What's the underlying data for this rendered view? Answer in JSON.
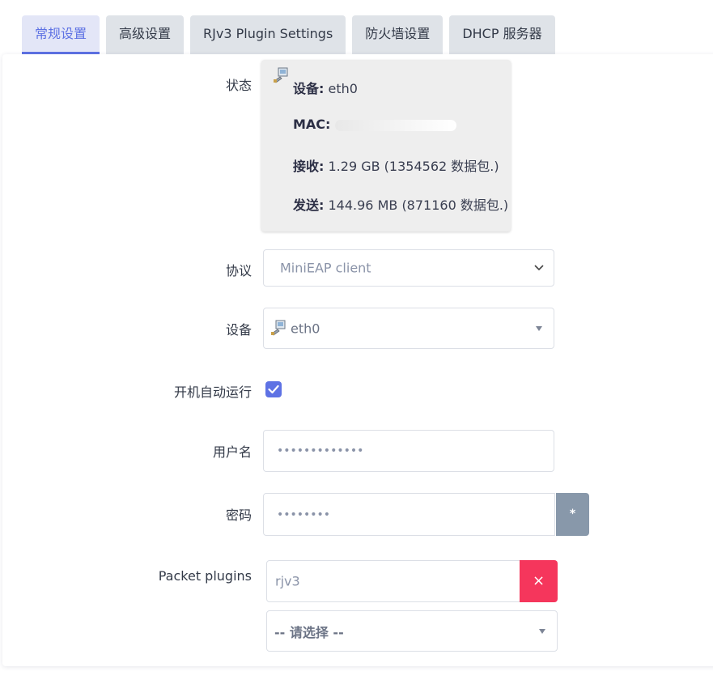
{
  "tabs": [
    {
      "label": "常规设置",
      "active": true
    },
    {
      "label": "高级设置",
      "active": false
    },
    {
      "label": "RJv3 Plugin Settings",
      "active": false
    },
    {
      "label": "防火墙设置",
      "active": false
    },
    {
      "label": "DHCP 服务器",
      "active": false
    }
  ],
  "status": {
    "label": "状态",
    "device_key": "设备:",
    "device_value": "eth0",
    "mac_key": "MAC:",
    "rx_key": "接收:",
    "rx_value": "1.29 GB (1354562 数据包.)",
    "tx_key": "发送:",
    "tx_value": "144.96 MB (871160 数据包.)"
  },
  "protocol": {
    "label": "协议",
    "value": "MiniEAP client"
  },
  "device": {
    "label": "设备",
    "value": "eth0"
  },
  "autostart": {
    "label": "开机自动运行",
    "checked": true
  },
  "username": {
    "label": "用户名",
    "value": "•••••••••••••"
  },
  "password": {
    "label": "密码",
    "value": "••••••••",
    "reveal_label": "*"
  },
  "packet_plugins": {
    "label": "Packet plugins",
    "value": "rjv3",
    "remove_label": "×",
    "select_placeholder": "-- 请选择 --"
  },
  "colors": {
    "accent": "#5e72e4",
    "danger": "#f5365c",
    "muted_button": "#8898aa"
  }
}
